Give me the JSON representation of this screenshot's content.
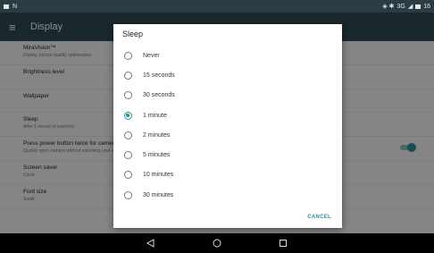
{
  "status_bar": {
    "indicator": "N",
    "signal": "3G",
    "battery": "16"
  },
  "app_bar": {
    "title": "Display",
    "menu_icon": "hamburger-menu-icon"
  },
  "settings": [
    {
      "title": "MiraVision™",
      "summary": "Display picture quality optimization"
    },
    {
      "title": "Brightness level",
      "summary": ""
    },
    {
      "title": "Wallpaper",
      "summary": ""
    },
    {
      "title": "Sleep",
      "summary": "After 1 minute of inactivity"
    },
    {
      "title": "Press power button twice for camera",
      "summary": "Quickly open camera without unlocking your screen"
    },
    {
      "title": "Screen saver",
      "summary": "Clock"
    },
    {
      "title": "Font size",
      "summary": "Small"
    }
  ],
  "dialog": {
    "title": "Sleep",
    "selected": "1 minute",
    "options": [
      "Never",
      "15 seconds",
      "30 seconds",
      "1 minute",
      "2 minutes",
      "5 minutes",
      "10 minutes",
      "30 minutes"
    ],
    "cancel_label": "CANCEL"
  },
  "nav_bar": {
    "back_icon": "back-triangle-icon",
    "home_icon": "home-circle-icon",
    "recents_icon": "recents-square-icon"
  },
  "colors": {
    "accent": "#2a8ea0",
    "app_bar": "#2f4a52",
    "status_bar": "#2a3d44"
  }
}
